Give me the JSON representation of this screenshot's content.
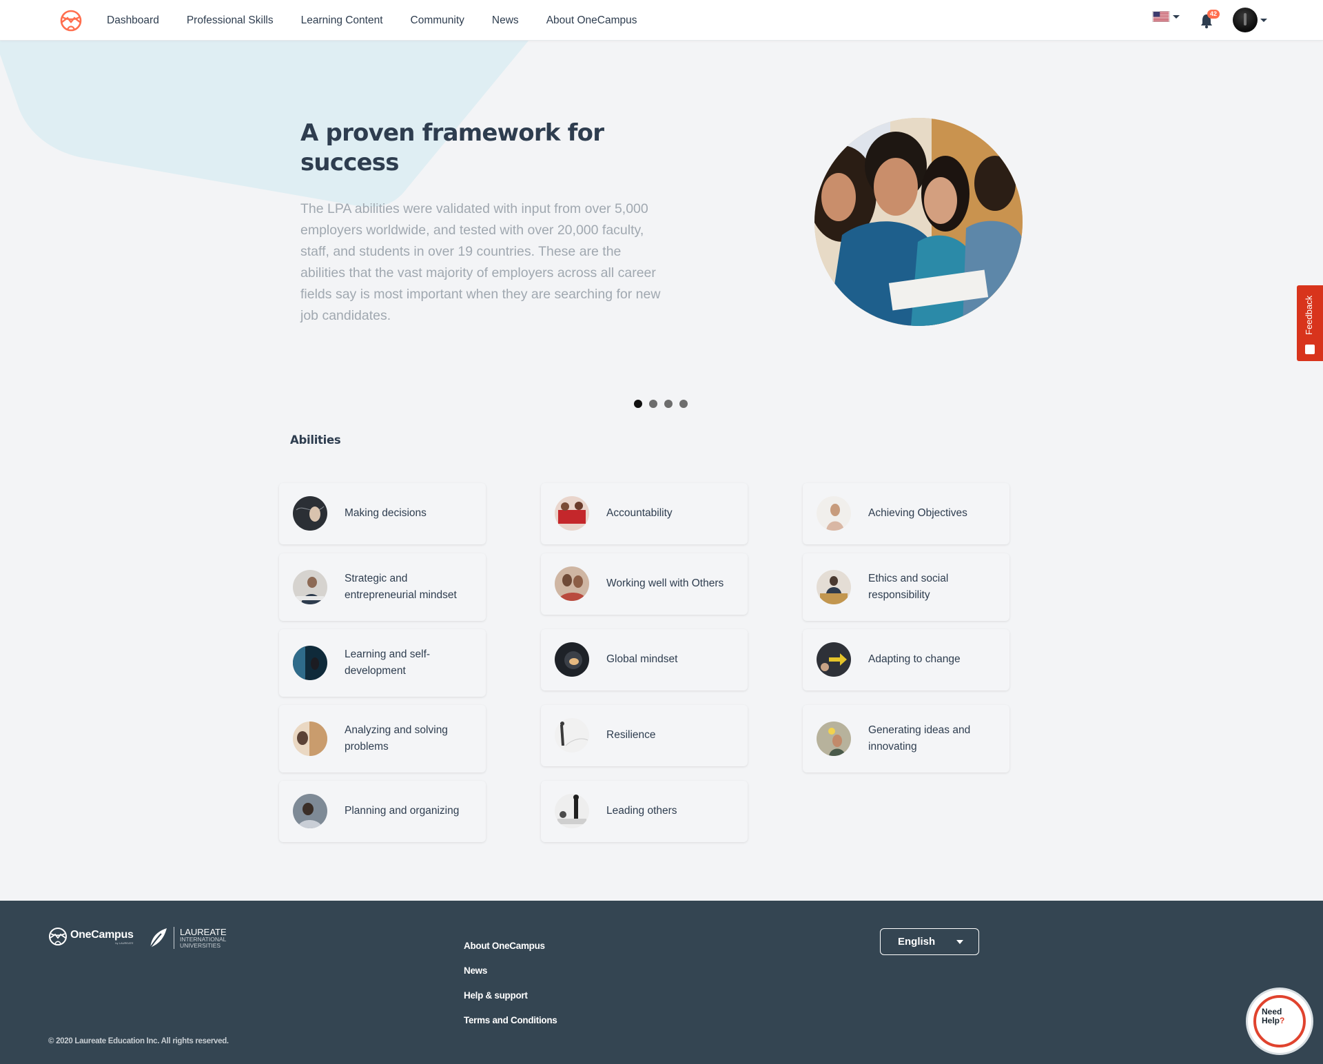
{
  "nav": {
    "links": [
      "Dashboard",
      "Professional Skills",
      "Learning Content",
      "Community",
      "News",
      "About OneCampus"
    ],
    "notification_count": "42"
  },
  "hero": {
    "title": "A proven framework for success",
    "text": "The LPA abilities were validated with input from over 5,000 employers worldwide, and tested with over 20,000 faculty, staff, and students in over 19 countries. These are the abilities that the vast majority of employers across all career fields say is most important when they are searching for new job candidates.",
    "slide_count": 4,
    "active_slide": 1
  },
  "feedback": {
    "label": "Feedback"
  },
  "abilities": {
    "title": "Abilities",
    "items": [
      "Making decisions",
      "Accountability",
      "Achieving Objectives",
      "Strategic and entrepreneurial mindset",
      "Working well with Others",
      "Ethics and social responsibility",
      "Learning and self-development",
      "Global mindset",
      "Adapting to change",
      "Analyzing and solving problems",
      "Resilience",
      "Generating ideas and innovating",
      "Planning and organizing",
      "Leading others"
    ]
  },
  "footer": {
    "brand": "OneCampus",
    "brand_sub": "by LAUREATE",
    "partner_main": "LAUREATE",
    "partner_sub1": "INTERNATIONAL",
    "partner_sub2": "UNIVERSITIES",
    "links": [
      "About OneCampus",
      "News",
      "Help & support",
      "Terms and Conditions"
    ],
    "language": "English",
    "copyright": "© 2020 Laureate Education Inc. All rights reserved.",
    "help_line1": "Need",
    "help_line2": "Help",
    "help_q": "?"
  },
  "colors": {
    "brand_orange": "#ff6e4e",
    "text_dark": "#2e3d4f",
    "footer_bg": "#344552",
    "feedback_red": "#d8341c"
  }
}
